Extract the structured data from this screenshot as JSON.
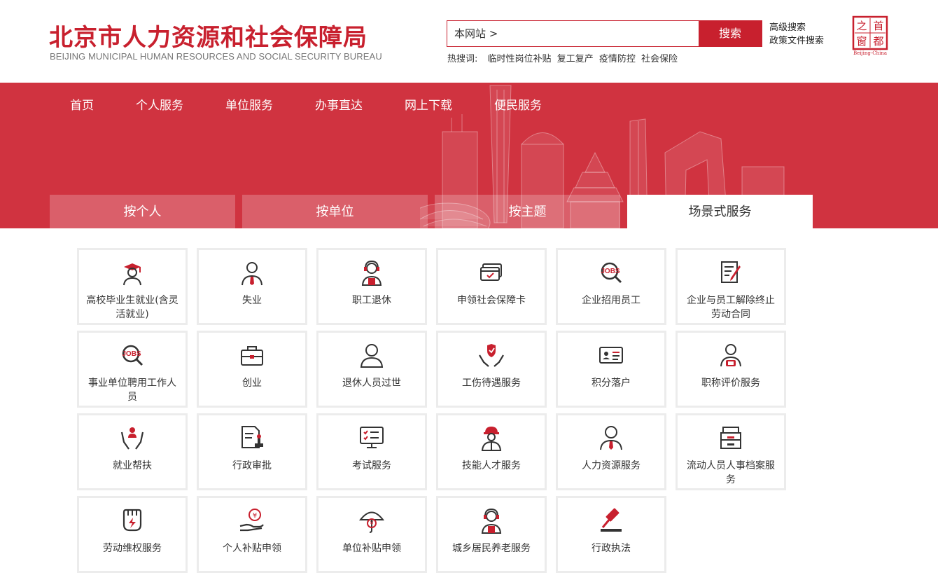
{
  "header": {
    "title_cn": "北京市人力资源和社会保障局",
    "title_en": "BEIJING MUNICIPAL HUMAN RESOURCES AND SOCIAL SECURITY BUREAU",
    "search_scope": "本网站 >",
    "search_button": "搜索",
    "advanced_search": "高级搜索",
    "policy_search": "政策文件搜索",
    "hot_label": "热搜词:",
    "hot_words": [
      "临时性岗位补贴",
      "复工复产",
      "疫情防控",
      "社会保险"
    ],
    "seal_text": [
      "首",
      "都",
      "之",
      "窗"
    ],
    "seal_caption": "Beijing-China"
  },
  "nav": [
    "首页",
    "个人服务",
    "单位服务",
    "办事直达",
    "网上下载",
    "便民服务"
  ],
  "tabs": [
    "按个人",
    "按单位",
    "按主题",
    "场景式服务"
  ],
  "active_tab": 3,
  "colors": {
    "brand": "#c8202e",
    "banner": "#d03340"
  },
  "services": [
    {
      "label": "高校毕业生就业(含灵活就业)",
      "icon": "graduate-icon"
    },
    {
      "label": "失业",
      "icon": "worker-tie-icon"
    },
    {
      "label": "职工退休",
      "icon": "headset-person-icon"
    },
    {
      "label": "申领社会保障卡",
      "icon": "social-card-icon"
    },
    {
      "label": "企业招用员工",
      "icon": "jobs-search-icon"
    },
    {
      "label": "企业与员工解除终止劳动合同",
      "icon": "contract-pen-icon"
    },
    {
      "label": "事业单位聘用工作人员",
      "icon": "jobs-search-icon"
    },
    {
      "label": "创业",
      "icon": "briefcase-icon"
    },
    {
      "label": "退休人员过世",
      "icon": "person-outline-icon"
    },
    {
      "label": "工伤待遇服务",
      "icon": "hands-shield-icon"
    },
    {
      "label": "积分落户",
      "icon": "id-card-icon"
    },
    {
      "label": "职称评价服务",
      "icon": "person-badge-icon"
    },
    {
      "label": "就业帮扶",
      "icon": "hands-person-icon"
    },
    {
      "label": "行政审批",
      "icon": "document-stamp-icon"
    },
    {
      "label": "考试服务",
      "icon": "monitor-checklist-icon"
    },
    {
      "label": "技能人才服务",
      "icon": "helmet-worker-icon"
    },
    {
      "label": "人力资源服务",
      "icon": "person-tie-icon"
    },
    {
      "label": "流动人员人事档案服务",
      "icon": "file-cabinet-icon"
    },
    {
      "label": "劳动维权服务",
      "icon": "fist-lightning-icon"
    },
    {
      "label": "个人补贴申领",
      "icon": "hand-coin-icon"
    },
    {
      "label": "单位补贴申领",
      "icon": "umbrella-coin-icon"
    },
    {
      "label": "城乡居民养老服务",
      "icon": "headset-person-icon"
    },
    {
      "label": "行政执法",
      "icon": "gavel-icon"
    }
  ]
}
